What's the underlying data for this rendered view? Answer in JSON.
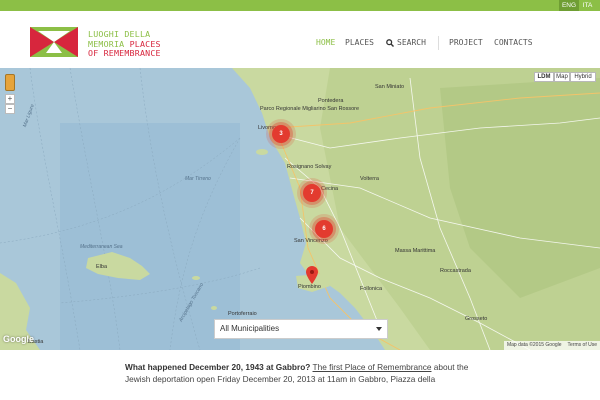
{
  "topbar": {
    "languages": [
      {
        "label": "ENG",
        "active": true
      },
      {
        "label": "ITA",
        "active": false
      }
    ],
    "color": "#8cbf46"
  },
  "logo": {
    "lines": [
      "LUOGHI DELLA",
      "MEMORIA ",
      "PLACES",
      "OF REMEMBRANCE"
    ],
    "colors": {
      "green": "#8cbf46",
      "red": "#d7263d"
    }
  },
  "nav": {
    "home": "HOME",
    "places": "PLACES",
    "search": "SEARCH",
    "project": "PROJECT",
    "contacts": "CONTACTS"
  },
  "map": {
    "map_types": [
      "LDM",
      "Map",
      "Hybrid"
    ],
    "zoom_in": "+",
    "zoom_out": "−",
    "clusters": [
      "3",
      "7",
      "6"
    ],
    "labels": {
      "sea_ligure": "Mar Ligure",
      "sea_mediterranean": "Mediterranean Sea",
      "sea_tirreno": "Mar Tirreno",
      "arcipelago": "Arcipelago Toscano",
      "elba": "Elba",
      "bastia": "Bastia",
      "livorno": "Livorno",
      "rosignano": "Rosignano Solvay",
      "cecina": "Cecina",
      "san_vincenzo": "San Vincenzo",
      "piombino": "Piombino",
      "portoferraio": "Portoferraio",
      "volterra": "Volterra",
      "massa_marittima": "Massa Marittima",
      "follonica": "Follonica",
      "grosseto": "Grosseto",
      "roccastrada": "Roccastrada",
      "san_miniato": "San Miniato",
      "pontedera": "Pontedera",
      "migliarino": "Parco Regionale Migliarino San Rossore"
    },
    "select": {
      "value": "All Municipalities"
    },
    "google": "Google",
    "attribution": "Map data ©2015 Google",
    "terms": "Terms of Use"
  },
  "content": {
    "question": "What happened December 20, 1943 at Gabbro?",
    "link": "The first Place of Remembrance",
    "rest": " about the Jewish deportation open Friday December 20, 2013 at 11am in Gabbro, Piazza della"
  }
}
